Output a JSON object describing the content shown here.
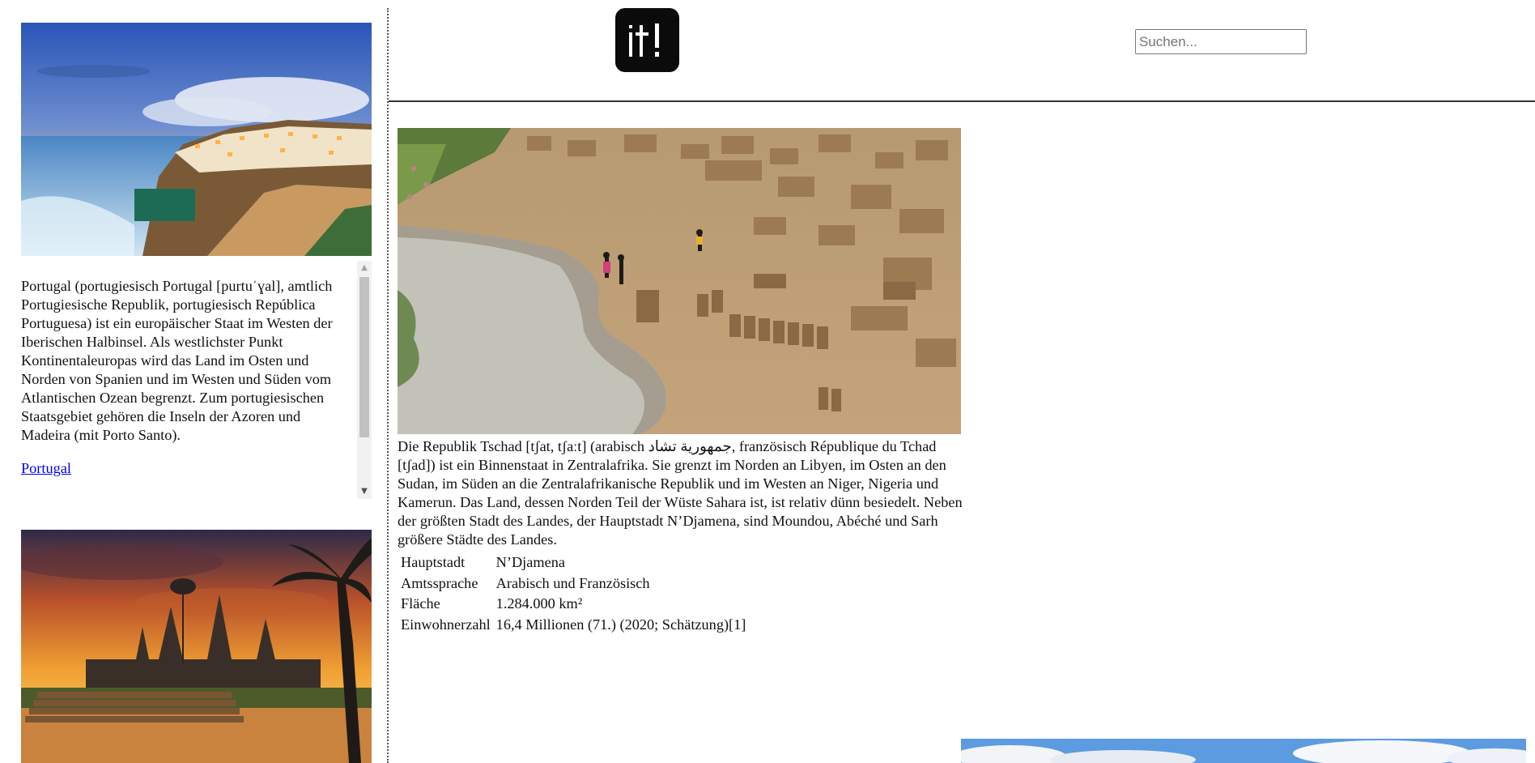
{
  "header": {
    "logo_text": "it!",
    "search_placeholder": "Suchen..."
  },
  "sidebar": {
    "cards": [
      {
        "image_icon": "portugal-coast-photo",
        "text": "Portugal (portugiesisch Portugal [purtuˈɣal], amtlich Portugiesische Republik, portugiesisch República Portuguesa) ist ein europäischer Staat im Westen der Iberischen Halbinsel. Als westlichster Punkt Kontinentaleuropas wird das Land im Osten und Norden von Spanien und im Westen und Süden vom Atlantischen Ozean begrenzt. Zum portugiesischen Staatsgebiet gehören die Inseln der Azoren und Madeira (mit Porto Santo).",
        "link": "Portugal"
      },
      {
        "image_icon": "angkor-wat-sunset-photo"
      }
    ]
  },
  "main": {
    "image_icon": "chad-mud-bricks-photo",
    "text": "Die Republik Tschad [tʃat, tʃaːt] (arabisch جمهورية تشاد, französisch République du Tchad [tʃad]) ist ein Binnenstaat in Zentralafrika. Sie grenzt im Norden an Libyen, im Osten an den Sudan, im Süden an die Zentralafrikanische Republik und im Westen an Niger, Nigeria und Kamerun. Das Land, dessen Norden Teil der Wüste Sahara ist, ist relativ dünn besiedelt. Neben der größten Stadt des Landes, der Hauptstadt N’Djamena, sind Moundou, Abéché und Sarh größere Städte des Landes.",
    "facts": [
      {
        "label": "Hauptstadt",
        "value": "N’Djamena"
      },
      {
        "label": "Amtssprache",
        "value": "Arabisch und Französisch"
      },
      {
        "label": "Fläche",
        "value": "1.284.000 km²"
      },
      {
        "label": "Einwohnerzahl",
        "value": "16,4 Millionen (71.) (2020; Schätzung)[1]"
      }
    ]
  },
  "teaser": {
    "image_icon": "sky-clouds-photo"
  },
  "colors": {
    "link": "#0000ee",
    "divider": "#333333",
    "logo_bg": "#0b0b0b"
  }
}
